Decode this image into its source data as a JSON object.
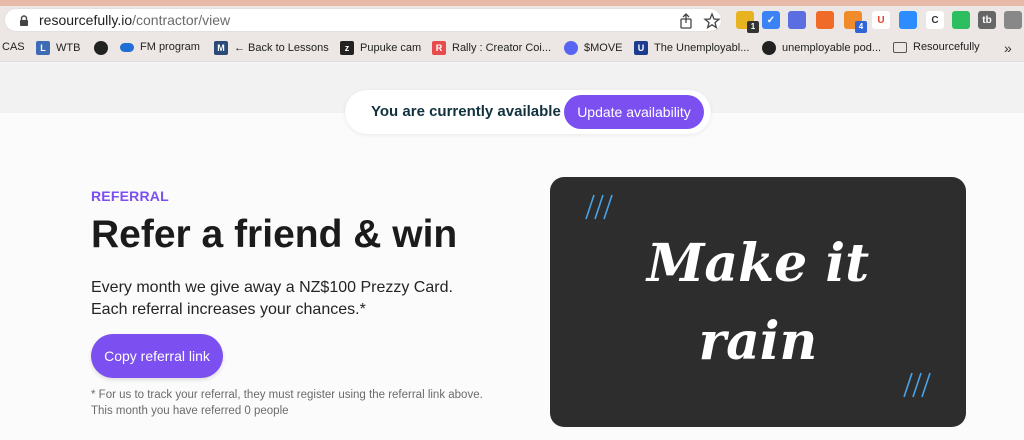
{
  "browser": {
    "url_host": "resourcefully.io",
    "url_path": "/contractor/view",
    "extensions": [
      {
        "name": "notes-ext",
        "color": "#e7b321",
        "label": "",
        "badge": "1"
      },
      {
        "name": "check-ext",
        "color": "#3b82f6",
        "label": "✓",
        "badge": ""
      },
      {
        "name": "user-ext",
        "color": "#5b6ee1",
        "label": "",
        "badge": ""
      },
      {
        "name": "chart-ext",
        "color": "#f06a28",
        "label": "",
        "badge": ""
      },
      {
        "name": "tags-ext",
        "color": "#f08a2a",
        "label": "",
        "badge": "4"
      },
      {
        "name": "u-ext",
        "color": "#ffffff",
        "label": "U",
        "badge": ""
      },
      {
        "name": "video-ext",
        "color": "#2d8cff",
        "label": "",
        "badge": ""
      },
      {
        "name": "c-ext",
        "color": "#ffffff",
        "label": "C",
        "badge": ""
      },
      {
        "name": "evernote-ext",
        "color": "#2dbe60",
        "label": "",
        "badge": ""
      },
      {
        "name": "tb-ext",
        "color": "#666666",
        "label": "tb",
        "badge": ""
      },
      {
        "name": "puzzle-ext",
        "color": "#888888",
        "label": "",
        "badge": ""
      }
    ],
    "bookmarks": [
      {
        "label": "CAS",
        "icon": "",
        "color": ""
      },
      {
        "label": "WTB",
        "icon": "L",
        "color": "#3f6bb5"
      },
      {
        "label": "",
        "icon": "globe",
        "color": "#222222"
      },
      {
        "label": "FM program",
        "icon": "cloud",
        "color": "#1f6fd6"
      },
      {
        "label": "← Back to Lessons",
        "icon": "M",
        "color": "#2b4a78"
      },
      {
        "label": "Pupuke cam",
        "icon": "z",
        "color": "#222222"
      },
      {
        "label": "Rally : Creator Coi...",
        "icon": "R",
        "color": "#e84b4b"
      },
      {
        "label": "$MOVE",
        "icon": "discord",
        "color": "#5865f2"
      },
      {
        "label": "The Unemployabl...",
        "icon": "U",
        "color": "#1d3c8f"
      },
      {
        "label": "unemployable pod...",
        "icon": "globe",
        "color": "#222222"
      },
      {
        "label": "Resourcefully",
        "icon": "folder",
        "color": "#555555"
      }
    ],
    "more": "»"
  },
  "availability": {
    "status_text": "You are currently available",
    "button_label": "Update availability"
  },
  "referral": {
    "eyebrow": "REFERRAL",
    "title": "Refer a friend & win",
    "desc_line1": "Every month we give away a NZ$100 Prezzy Card.",
    "desc_line2": "Each referral increases your chances.*",
    "copy_button": "Copy referral link",
    "fine_line1": "* For us to track your referral, they must register using the referral link above.",
    "fine_line2": "This month you have referred 0 people"
  },
  "promo": {
    "line1": "Make it",
    "line2": "rain"
  },
  "colors": {
    "accent": "#7b4ff0",
    "promo_bg": "#2d2d2d"
  }
}
